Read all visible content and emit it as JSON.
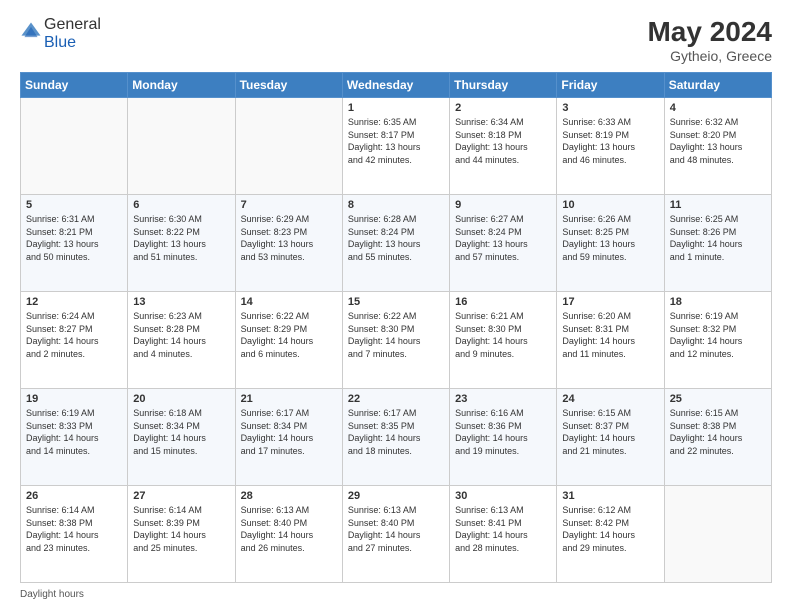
{
  "header": {
    "logo_general": "General",
    "logo_blue": "Blue",
    "month_year": "May 2024",
    "location": "Gytheio, Greece"
  },
  "weekdays": [
    "Sunday",
    "Monday",
    "Tuesday",
    "Wednesday",
    "Thursday",
    "Friday",
    "Saturday"
  ],
  "footer": {
    "daylight_label": "Daylight hours"
  },
  "weeks": [
    [
      {
        "day": "",
        "info": ""
      },
      {
        "day": "",
        "info": ""
      },
      {
        "day": "",
        "info": ""
      },
      {
        "day": "1",
        "info": "Sunrise: 6:35 AM\nSunset: 8:17 PM\nDaylight: 13 hours\nand 42 minutes."
      },
      {
        "day": "2",
        "info": "Sunrise: 6:34 AM\nSunset: 8:18 PM\nDaylight: 13 hours\nand 44 minutes."
      },
      {
        "day": "3",
        "info": "Sunrise: 6:33 AM\nSunset: 8:19 PM\nDaylight: 13 hours\nand 46 minutes."
      },
      {
        "day": "4",
        "info": "Sunrise: 6:32 AM\nSunset: 8:20 PM\nDaylight: 13 hours\nand 48 minutes."
      }
    ],
    [
      {
        "day": "5",
        "info": "Sunrise: 6:31 AM\nSunset: 8:21 PM\nDaylight: 13 hours\nand 50 minutes."
      },
      {
        "day": "6",
        "info": "Sunrise: 6:30 AM\nSunset: 8:22 PM\nDaylight: 13 hours\nand 51 minutes."
      },
      {
        "day": "7",
        "info": "Sunrise: 6:29 AM\nSunset: 8:23 PM\nDaylight: 13 hours\nand 53 minutes."
      },
      {
        "day": "8",
        "info": "Sunrise: 6:28 AM\nSunset: 8:24 PM\nDaylight: 13 hours\nand 55 minutes."
      },
      {
        "day": "9",
        "info": "Sunrise: 6:27 AM\nSunset: 8:24 PM\nDaylight: 13 hours\nand 57 minutes."
      },
      {
        "day": "10",
        "info": "Sunrise: 6:26 AM\nSunset: 8:25 PM\nDaylight: 13 hours\nand 59 minutes."
      },
      {
        "day": "11",
        "info": "Sunrise: 6:25 AM\nSunset: 8:26 PM\nDaylight: 14 hours\nand 1 minute."
      }
    ],
    [
      {
        "day": "12",
        "info": "Sunrise: 6:24 AM\nSunset: 8:27 PM\nDaylight: 14 hours\nand 2 minutes."
      },
      {
        "day": "13",
        "info": "Sunrise: 6:23 AM\nSunset: 8:28 PM\nDaylight: 14 hours\nand 4 minutes."
      },
      {
        "day": "14",
        "info": "Sunrise: 6:22 AM\nSunset: 8:29 PM\nDaylight: 14 hours\nand 6 minutes."
      },
      {
        "day": "15",
        "info": "Sunrise: 6:22 AM\nSunset: 8:30 PM\nDaylight: 14 hours\nand 7 minutes."
      },
      {
        "day": "16",
        "info": "Sunrise: 6:21 AM\nSunset: 8:30 PM\nDaylight: 14 hours\nand 9 minutes."
      },
      {
        "day": "17",
        "info": "Sunrise: 6:20 AM\nSunset: 8:31 PM\nDaylight: 14 hours\nand 11 minutes."
      },
      {
        "day": "18",
        "info": "Sunrise: 6:19 AM\nSunset: 8:32 PM\nDaylight: 14 hours\nand 12 minutes."
      }
    ],
    [
      {
        "day": "19",
        "info": "Sunrise: 6:19 AM\nSunset: 8:33 PM\nDaylight: 14 hours\nand 14 minutes."
      },
      {
        "day": "20",
        "info": "Sunrise: 6:18 AM\nSunset: 8:34 PM\nDaylight: 14 hours\nand 15 minutes."
      },
      {
        "day": "21",
        "info": "Sunrise: 6:17 AM\nSunset: 8:34 PM\nDaylight: 14 hours\nand 17 minutes."
      },
      {
        "day": "22",
        "info": "Sunrise: 6:17 AM\nSunset: 8:35 PM\nDaylight: 14 hours\nand 18 minutes."
      },
      {
        "day": "23",
        "info": "Sunrise: 6:16 AM\nSunset: 8:36 PM\nDaylight: 14 hours\nand 19 minutes."
      },
      {
        "day": "24",
        "info": "Sunrise: 6:15 AM\nSunset: 8:37 PM\nDaylight: 14 hours\nand 21 minutes."
      },
      {
        "day": "25",
        "info": "Sunrise: 6:15 AM\nSunset: 8:38 PM\nDaylight: 14 hours\nand 22 minutes."
      }
    ],
    [
      {
        "day": "26",
        "info": "Sunrise: 6:14 AM\nSunset: 8:38 PM\nDaylight: 14 hours\nand 23 minutes."
      },
      {
        "day": "27",
        "info": "Sunrise: 6:14 AM\nSunset: 8:39 PM\nDaylight: 14 hours\nand 25 minutes."
      },
      {
        "day": "28",
        "info": "Sunrise: 6:13 AM\nSunset: 8:40 PM\nDaylight: 14 hours\nand 26 minutes."
      },
      {
        "day": "29",
        "info": "Sunrise: 6:13 AM\nSunset: 8:40 PM\nDaylight: 14 hours\nand 27 minutes."
      },
      {
        "day": "30",
        "info": "Sunrise: 6:13 AM\nSunset: 8:41 PM\nDaylight: 14 hours\nand 28 minutes."
      },
      {
        "day": "31",
        "info": "Sunrise: 6:12 AM\nSunset: 8:42 PM\nDaylight: 14 hours\nand 29 minutes."
      },
      {
        "day": "",
        "info": ""
      }
    ]
  ]
}
